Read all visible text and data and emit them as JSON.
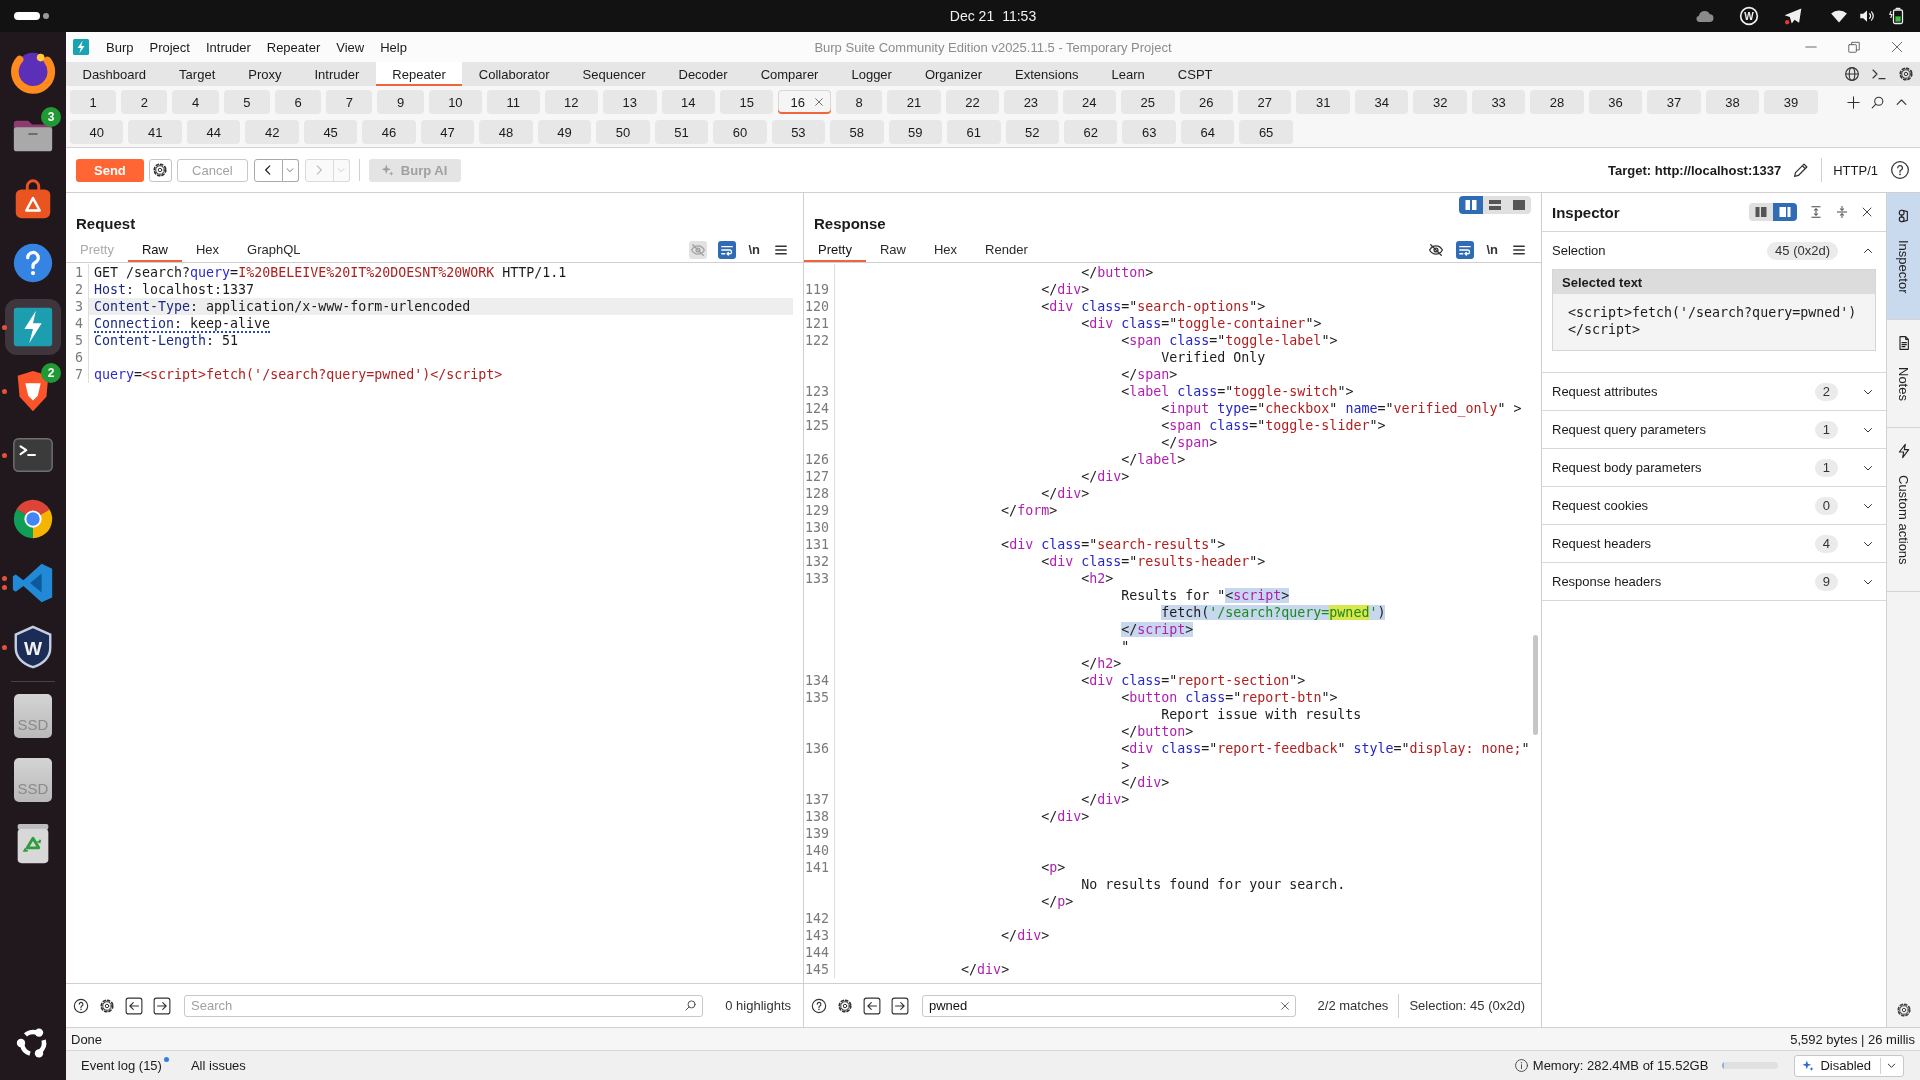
{
  "system_bar": {
    "date": "Dec 21",
    "time": "11:53",
    "tray_logo_letter": "W"
  },
  "dock": {
    "apps": [
      {
        "kind": "globe",
        "running": false,
        "several_windows": false,
        "selected": false
      },
      {
        "kind": "folder",
        "badge": "3",
        "running": false,
        "several_windows": false,
        "selected": false
      },
      {
        "kind": "bag",
        "running": false,
        "several_windows": false,
        "selected": false
      },
      {
        "kind": "help",
        "running": false,
        "several_windows": false,
        "selected": false
      },
      {
        "kind": "bolt",
        "running": true,
        "several_windows": false,
        "selected": true
      },
      {
        "kind": "shield",
        "badge": "2",
        "running": true,
        "several_windows": false,
        "selected": false
      },
      {
        "kind": "terminal",
        "running": true,
        "several_windows": false,
        "selected": false
      },
      {
        "kind": "wheel",
        "running": false,
        "several_windows": false,
        "selected": false
      },
      {
        "kind": "ribbon",
        "running": true,
        "several_windows": true,
        "selected": false
      },
      {
        "kind": "letter",
        "label": "W",
        "running": true,
        "several_windows": false,
        "selected": false
      }
    ],
    "devices": [
      {
        "kind": "drive",
        "label": "SSD"
      },
      {
        "kind": "drive",
        "label": "SSD"
      },
      {
        "kind": "recycle"
      }
    ]
  },
  "window": {
    "title": "Burp Suite Community Edition v2025.11.5 - Temporary Project",
    "menu": [
      "Burp",
      "Project",
      "Intruder",
      "Repeater",
      "View",
      "Help"
    ]
  },
  "tool_tabs": [
    {
      "label": "Dashboard",
      "selected": false
    },
    {
      "label": "Target",
      "selected": false
    },
    {
      "label": "Proxy",
      "selected": false
    },
    {
      "label": "Intruder",
      "selected": false
    },
    {
      "label": "Repeater",
      "selected": true
    },
    {
      "label": "Collaborator",
      "selected": false
    },
    {
      "label": "Sequencer",
      "selected": false
    },
    {
      "label": "Decoder",
      "selected": false
    },
    {
      "label": "Comparer",
      "selected": false
    },
    {
      "label": "Logger",
      "selected": false
    },
    {
      "label": "Organizer",
      "selected": false
    },
    {
      "label": "Extensions",
      "selected": false
    },
    {
      "label": "Learn",
      "selected": false
    },
    {
      "label": "CSPT",
      "selected": false
    }
  ],
  "repeater_tabs": [
    {
      "label": "1",
      "selected": false
    },
    {
      "label": "2",
      "selected": false
    },
    {
      "label": "4",
      "selected": false
    },
    {
      "label": "5",
      "selected": false
    },
    {
      "label": "6",
      "selected": false
    },
    {
      "label": "7",
      "selected": false
    },
    {
      "label": "9",
      "selected": false
    },
    {
      "label": "10",
      "selected": false
    },
    {
      "label": "11",
      "selected": false
    },
    {
      "label": "12",
      "selected": false
    },
    {
      "label": "13",
      "selected": false
    },
    {
      "label": "14",
      "selected": false
    },
    {
      "label": "15",
      "selected": false
    },
    {
      "label": "16",
      "selected": true
    },
    {
      "label": "8",
      "selected": false
    },
    {
      "label": "21",
      "selected": false
    },
    {
      "label": "22",
      "selected": false
    },
    {
      "label": "23",
      "selected": false
    },
    {
      "label": "24",
      "selected": false
    },
    {
      "label": "25",
      "selected": false
    },
    {
      "label": "26",
      "selected": false
    },
    {
      "label": "27",
      "selected": false
    },
    {
      "label": "31",
      "selected": false
    },
    {
      "label": "34",
      "selected": false
    },
    {
      "label": "32",
      "selected": false
    },
    {
      "label": "33",
      "selected": false
    },
    {
      "label": "28",
      "selected": false
    },
    {
      "label": "36",
      "selected": false
    },
    {
      "label": "37",
      "selected": false
    },
    {
      "label": "38",
      "selected": false
    },
    {
      "label": "39",
      "selected": false
    },
    {
      "label": "40",
      "selected": false
    },
    {
      "label": "41",
      "selected": false
    },
    {
      "label": "44",
      "selected": false
    },
    {
      "label": "42",
      "selected": false
    },
    {
      "label": "45",
      "selected": false
    },
    {
      "label": "46",
      "selected": false
    },
    {
      "label": "47",
      "selected": false
    },
    {
      "label": "48",
      "selected": false
    },
    {
      "label": "49",
      "selected": false
    },
    {
      "label": "50",
      "selected": false
    },
    {
      "label": "51",
      "selected": false
    },
    {
      "label": "60",
      "selected": false
    },
    {
      "label": "53",
      "selected": false
    },
    {
      "label": "58",
      "selected": false
    },
    {
      "label": "59",
      "selected": false
    },
    {
      "label": "61",
      "selected": false
    },
    {
      "label": "52",
      "selected": false
    },
    {
      "label": "62",
      "selected": false
    },
    {
      "label": "63",
      "selected": false
    },
    {
      "label": "64",
      "selected": false
    },
    {
      "label": "65",
      "selected": false
    }
  ],
  "toolbar": {
    "buttons": [
      {
        "kind": "send",
        "label": "Send",
        "disabled": false
      },
      {
        "kind": "settings",
        "disabled": false
      },
      {
        "kind": "cancel",
        "label": "Cancel",
        "disabled": true
      },
      {
        "kind": "back",
        "disabled": false
      },
      {
        "kind": "forward",
        "disabled": true
      },
      {
        "kind": "ai",
        "label": "Burp AI",
        "disabled": true
      }
    ],
    "target": "Target: http://localhost:1337",
    "protocol": "HTTP/1"
  },
  "request": {
    "title": "Request",
    "tabs": [
      {
        "label": "Pretty",
        "selected": false,
        "disabled": true
      },
      {
        "label": "Raw",
        "selected": true,
        "disabled": false
      },
      {
        "label": "Hex",
        "selected": false,
        "disabled": false
      },
      {
        "label": "GraphQL",
        "selected": false,
        "disabled": false
      }
    ],
    "view_options": [
      {
        "kind": "hide",
        "on": false,
        "disabled": true
      },
      {
        "kind": "wrap",
        "on": true,
        "disabled": false
      },
      {
        "kind": "newline",
        "label": "\\n",
        "on": false,
        "disabled": false
      },
      {
        "kind": "menu",
        "on": false,
        "disabled": false
      }
    ],
    "lines": [
      {
        "num": "1",
        "current": false,
        "flagged": false,
        "tokens": [
          {
            "kind": "plain",
            "text": "GET /search?"
          },
          {
            "kind": "param",
            "text": "query"
          },
          {
            "kind": "plain",
            "text": "="
          },
          {
            "kind": "value",
            "text": "I%20BELEIVE%20IT%20DOESNT%20WORK"
          },
          {
            "kind": "plain",
            "text": " HTTP/1.1"
          }
        ]
      },
      {
        "num": "2",
        "current": false,
        "flagged": false,
        "tokens": [
          {
            "kind": "header",
            "text": "Host"
          },
          {
            "kind": "plain",
            "text": ": localhost:1337"
          }
        ]
      },
      {
        "num": "3",
        "current": true,
        "flagged": false,
        "tokens": [
          {
            "kind": "header",
            "text": "Content-Type"
          },
          {
            "kind": "plain",
            "text": ": application/x-www-form-urlencoded"
          }
        ]
      },
      {
        "num": "4",
        "current": false,
        "flagged": true,
        "tokens": [
          {
            "kind": "header",
            "text": "Connection"
          },
          {
            "kind": "plain",
            "text": ": keep-alive"
          }
        ]
      },
      {
        "num": "5",
        "current": false,
        "flagged": false,
        "tokens": [
          {
            "kind": "header",
            "text": "Content-Length"
          },
          {
            "kind": "plain",
            "text": ": 51"
          }
        ]
      },
      {
        "num": "6",
        "current": false
      },
      {
        "num": "7",
        "current": false,
        "flagged": false,
        "tokens": [
          {
            "kind": "param",
            "text": "query"
          },
          {
            "kind": "plain",
            "text": "="
          },
          {
            "kind": "value",
            "text": "<script>fetch('/search?query=pwned')</script>"
          }
        ]
      }
    ],
    "search": {
      "placeholder": "Search"
    },
    "result": "0 highlights"
  },
  "response": {
    "title": "Response",
    "layout_options": [
      {
        "kind": "columns",
        "selected": true
      },
      {
        "kind": "rows",
        "selected": false
      },
      {
        "kind": "single",
        "selected": false
      }
    ],
    "tabs": [
      {
        "label": "Pretty",
        "selected": true,
        "disabled": false
      },
      {
        "label": "Raw",
        "selected": false,
        "disabled": false
      },
      {
        "label": "Hex",
        "selected": false,
        "disabled": false
      },
      {
        "label": "Render",
        "selected": false,
        "disabled": false
      }
    ],
    "view_options": [
      {
        "kind": "hide",
        "on": false,
        "disabled": false
      },
      {
        "kind": "wrap",
        "on": true,
        "disabled": false
      },
      {
        "kind": "newline",
        "label": "\\n",
        "on": false,
        "disabled": false
      },
      {
        "kind": "menu",
        "on": false,
        "disabled": false
      }
    ],
    "lines": [
      {
        "tokens": [
          {
            "kind": "plain",
            "text": "                              </"
          },
          {
            "kind": "tag",
            "text": "button"
          },
          {
            "kind": "plain",
            "text": ">"
          }
        ]
      },
      {
        "num": "119",
        "tokens": [
          {
            "kind": "plain",
            "text": "                         </"
          },
          {
            "kind": "tag",
            "text": "div"
          },
          {
            "kind": "plain",
            "text": ">"
          }
        ]
      },
      {
        "num": "120",
        "tokens": [
          {
            "kind": "plain",
            "text": "                         <"
          },
          {
            "kind": "tag",
            "text": "div"
          },
          {
            "kind": "attr",
            "text": " class"
          },
          {
            "kind": "plain",
            "text": "=\""
          },
          {
            "kind": "value",
            "text": "search-options"
          },
          {
            "kind": "plain",
            "text": "\">"
          }
        ]
      },
      {
        "num": "121",
        "tokens": [
          {
            "kind": "plain",
            "text": "                              <"
          },
          {
            "kind": "tag",
            "text": "div"
          },
          {
            "kind": "attr",
            "text": " class"
          },
          {
            "kind": "plain",
            "text": "=\""
          },
          {
            "kind": "value",
            "text": "toggle-container"
          },
          {
            "kind": "plain",
            "text": "\">"
          }
        ]
      },
      {
        "num": "122",
        "tokens": [
          {
            "kind": "plain",
            "text": "                                   <"
          },
          {
            "kind": "tag",
            "text": "span"
          },
          {
            "kind": "attr",
            "text": " class"
          },
          {
            "kind": "plain",
            "text": "=\""
          },
          {
            "kind": "value",
            "text": "toggle-label"
          },
          {
            "kind": "plain",
            "text": "\">"
          }
        ]
      },
      {
        "tokens": [
          {
            "kind": "plain",
            "text": "                                        Verified Only"
          }
        ]
      },
      {
        "tokens": [
          {
            "kind": "plain",
            "text": "                                   </"
          },
          {
            "kind": "tag",
            "text": "span"
          },
          {
            "kind": "plain",
            "text": ">"
          }
        ]
      },
      {
        "num": "123",
        "tokens": [
          {
            "kind": "plain",
            "text": "                                   <"
          },
          {
            "kind": "tag",
            "text": "label"
          },
          {
            "kind": "attr",
            "text": " class"
          },
          {
            "kind": "plain",
            "text": "=\""
          },
          {
            "kind": "value",
            "text": "toggle-switch"
          },
          {
            "kind": "plain",
            "text": "\">"
          }
        ]
      },
      {
        "num": "124",
        "tokens": [
          {
            "kind": "plain",
            "text": "                                        <"
          },
          {
            "kind": "tag",
            "text": "input"
          },
          {
            "kind": "attr",
            "text": " type"
          },
          {
            "kind": "plain",
            "text": "=\""
          },
          {
            "kind": "value",
            "text": "checkbox"
          },
          {
            "kind": "plain",
            "text": "\""
          },
          {
            "kind": "attr",
            "text": " name"
          },
          {
            "kind": "plain",
            "text": "=\""
          },
          {
            "kind": "value",
            "text": "verified_only"
          },
          {
            "kind": "plain",
            "text": "\" >"
          }
        ]
      },
      {
        "num": "125",
        "tokens": [
          {
            "kind": "plain",
            "text": "                                        <"
          },
          {
            "kind": "tag",
            "text": "span"
          },
          {
            "kind": "attr",
            "text": " class"
          },
          {
            "kind": "plain",
            "text": "=\""
          },
          {
            "kind": "value",
            "text": "toggle-slider"
          },
          {
            "kind": "plain",
            "text": "\">"
          }
        ]
      },
      {
        "tokens": [
          {
            "kind": "plain",
            "text": "                                        </"
          },
          {
            "kind": "tag",
            "text": "span"
          },
          {
            "kind": "plain",
            "text": ">"
          }
        ]
      },
      {
        "num": "126",
        "tokens": [
          {
            "kind": "plain",
            "text": "                                   </"
          },
          {
            "kind": "tag",
            "text": "label"
          },
          {
            "kind": "plain",
            "text": ">"
          }
        ]
      },
      {
        "num": "127",
        "tokens": [
          {
            "kind": "plain",
            "text": "                              </"
          },
          {
            "kind": "tag",
            "text": "div"
          },
          {
            "kind": "plain",
            "text": ">"
          }
        ]
      },
      {
        "num": "128",
        "tokens": [
          {
            "kind": "plain",
            "text": "                         </"
          },
          {
            "kind": "tag",
            "text": "div"
          },
          {
            "kind": "plain",
            "text": ">"
          }
        ]
      },
      {
        "num": "129",
        "tokens": [
          {
            "kind": "plain",
            "text": "                    </"
          },
          {
            "kind": "tag",
            "text": "form"
          },
          {
            "kind": "plain",
            "text": ">"
          }
        ]
      },
      {
        "num": "130"
      },
      {
        "num": "131",
        "tokens": [
          {
            "kind": "plain",
            "text": "                    <"
          },
          {
            "kind": "tag",
            "text": "div"
          },
          {
            "kind": "attr",
            "text": " class"
          },
          {
            "kind": "plain",
            "text": "=\""
          },
          {
            "kind": "value",
            "text": "search-results"
          },
          {
            "kind": "plain",
            "text": "\">"
          }
        ]
      },
      {
        "num": "132",
        "tokens": [
          {
            "kind": "plain",
            "text": "                         <"
          },
          {
            "kind": "tag",
            "text": "div"
          },
          {
            "kind": "attr",
            "text": " class"
          },
          {
            "kind": "plain",
            "text": "=\""
          },
          {
            "kind": "value",
            "text": "results-header"
          },
          {
            "kind": "plain",
            "text": "\">"
          }
        ]
      },
      {
        "num": "133",
        "tokens": [
          {
            "kind": "plain",
            "text": "                              <"
          },
          {
            "kind": "tag",
            "text": "h2"
          },
          {
            "kind": "plain",
            "text": ">"
          }
        ]
      },
      {
        "tokens": [
          {
            "kind": "plain",
            "text": "                                   Results for \"",
            "selected": false,
            "match": false
          },
          {
            "kind": "plain",
            "text": "<",
            "selected": true,
            "match": false
          },
          {
            "kind": "tag",
            "text": "script",
            "selected": true,
            "match": false
          },
          {
            "kind": "plain",
            "text": ">",
            "selected": true,
            "match": false
          }
        ]
      },
      {
        "tokens": [
          {
            "kind": "plain",
            "text": "                                        fetch(",
            "selected": true,
            "match": false
          },
          {
            "kind": "string",
            "text": "'/search?query=",
            "selected": true,
            "match": false
          },
          {
            "kind": "string",
            "text": "pwned",
            "selected": true,
            "match": true
          },
          {
            "kind": "string",
            "text": "'",
            "selected": true,
            "match": false
          },
          {
            "kind": "plain",
            "text": ")",
            "selected": true,
            "match": false
          }
        ]
      },
      {
        "tokens": [
          {
            "kind": "plain",
            "text": "                                   </",
            "selected": true,
            "match": false
          },
          {
            "kind": "tag",
            "text": "script",
            "selected": true,
            "match": false
          },
          {
            "kind": "plain",
            "text": ">",
            "selected": true,
            "match": false
          }
        ]
      },
      {
        "tokens": [
          {
            "kind": "plain",
            "text": "                                   \""
          }
        ]
      },
      {
        "tokens": [
          {
            "kind": "plain",
            "text": "                              </"
          },
          {
            "kind": "tag",
            "text": "h2"
          },
          {
            "kind": "plain",
            "text": ">"
          }
        ]
      },
      {
        "num": "134",
        "tokens": [
          {
            "kind": "plain",
            "text": "                              <"
          },
          {
            "kind": "tag",
            "text": "div"
          },
          {
            "kind": "attr",
            "text": " class"
          },
          {
            "kind": "plain",
            "text": "=\""
          },
          {
            "kind": "value",
            "text": "report-section"
          },
          {
            "kind": "plain",
            "text": "\">"
          }
        ]
      },
      {
        "num": "135",
        "tokens": [
          {
            "kind": "plain",
            "text": "                                   <"
          },
          {
            "kind": "tag",
            "text": "button"
          },
          {
            "kind": "attr",
            "text": " class"
          },
          {
            "kind": "plain",
            "text": "=\""
          },
          {
            "kind": "value",
            "text": "report-btn"
          },
          {
            "kind": "plain",
            "text": "\">"
          }
        ]
      },
      {
        "tokens": [
          {
            "kind": "plain",
            "text": "                                        Report issue with results"
          }
        ]
      },
      {
        "tokens": [
          {
            "kind": "plain",
            "text": "                                   </"
          },
          {
            "kind": "tag",
            "text": "button"
          },
          {
            "kind": "plain",
            "text": ">"
          }
        ]
      },
      {
        "num": "136",
        "tokens": [
          {
            "kind": "plain",
            "text": "                                   <"
          },
          {
            "kind": "tag",
            "text": "div"
          },
          {
            "kind": "attr",
            "text": " class"
          },
          {
            "kind": "plain",
            "text": "=\""
          },
          {
            "kind": "value",
            "text": "report-feedback"
          },
          {
            "kind": "plain",
            "text": "\""
          },
          {
            "kind": "attr",
            "text": " style"
          },
          {
            "kind": "plain",
            "text": "=\""
          },
          {
            "kind": "value",
            "text": "display: none;"
          },
          {
            "kind": "plain",
            "text": "\""
          }
        ]
      },
      {
        "tokens": [
          {
            "kind": "plain",
            "text": "                                   >"
          }
        ]
      },
      {
        "tokens": [
          {
            "kind": "plain",
            "text": "                                   </"
          },
          {
            "kind": "tag",
            "text": "div"
          },
          {
            "kind": "plain",
            "text": ">"
          }
        ]
      },
      {
        "num": "137",
        "tokens": [
          {
            "kind": "plain",
            "text": "                              </"
          },
          {
            "kind": "tag",
            "text": "div"
          },
          {
            "kind": "plain",
            "text": ">"
          }
        ]
      },
      {
        "num": "138",
        "tokens": [
          {
            "kind": "plain",
            "text": "                         </"
          },
          {
            "kind": "tag",
            "text": "div"
          },
          {
            "kind": "plain",
            "text": ">"
          }
        ]
      },
      {
        "num": "139"
      },
      {
        "num": "140"
      },
      {
        "num": "141",
        "tokens": [
          {
            "kind": "plain",
            "text": "                         <"
          },
          {
            "kind": "tag",
            "text": "p"
          },
          {
            "kind": "plain",
            "text": ">"
          }
        ]
      },
      {
        "tokens": [
          {
            "kind": "plain",
            "text": "                              No results found for your search."
          }
        ]
      },
      {
        "tokens": [
          {
            "kind": "plain",
            "text": "                         </"
          },
          {
            "kind": "tag",
            "text": "p"
          },
          {
            "kind": "plain",
            "text": ">"
          }
        ]
      },
      {
        "num": "142"
      },
      {
        "num": "143",
        "tokens": [
          {
            "kind": "plain",
            "text": "                    </"
          },
          {
            "kind": "tag",
            "text": "div"
          },
          {
            "kind": "plain",
            "text": ">"
          }
        ]
      },
      {
        "num": "144"
      },
      {
        "num": "145",
        "tokens": [
          {
            "kind": "plain",
            "text": "               </"
          },
          {
            "kind": "tag",
            "text": "div"
          },
          {
            "kind": "plain",
            "text": ">"
          }
        ]
      }
    ],
    "search": {
      "value": "pwned"
    },
    "result": "2/2 matches",
    "selection": "Selection: 45 (0x2d)"
  },
  "inspector": {
    "title": "Inspector",
    "layout_options": [
      {
        "kind": "left",
        "selected": false
      },
      {
        "kind": "right",
        "selected": true
      }
    ],
    "sections": [
      {
        "title": "Selection",
        "count": "45 (0x2d)",
        "expanded": true,
        "content": {
          "title": "Selected text",
          "text": "<script>fetch('/search?query=pwned')</script>"
        }
      },
      {
        "title": "Request attributes",
        "count": "2",
        "expanded": false
      },
      {
        "title": "Request query parameters",
        "count": "1",
        "expanded": false
      },
      {
        "title": "Request body parameters",
        "count": "1",
        "expanded": false
      },
      {
        "title": "Request cookies",
        "count": "0",
        "expanded": false
      },
      {
        "title": "Request headers",
        "count": "4",
        "expanded": false
      },
      {
        "title": "Response headers",
        "count": "9",
        "expanded": false
      }
    ]
  },
  "side_tabs": [
    {
      "kind": "inspector",
      "label": "Inspector",
      "selected": true
    },
    {
      "kind": "notes",
      "label": "Notes",
      "selected": false
    },
    {
      "kind": "actions",
      "label": "Custom actions",
      "selected": false
    }
  ],
  "status_bar": {
    "message": "Done",
    "stats": "5,592 bytes | 26 millis"
  },
  "bottom_bar": {
    "event_log": {
      "label": "Event log (15)",
      "unread": true
    },
    "all_issues": "All issues",
    "memory": {
      "label": "Memory: 282.4MB of 15.52GB",
      "level": 0.02
    },
    "ai_status": "Disabled"
  }
}
